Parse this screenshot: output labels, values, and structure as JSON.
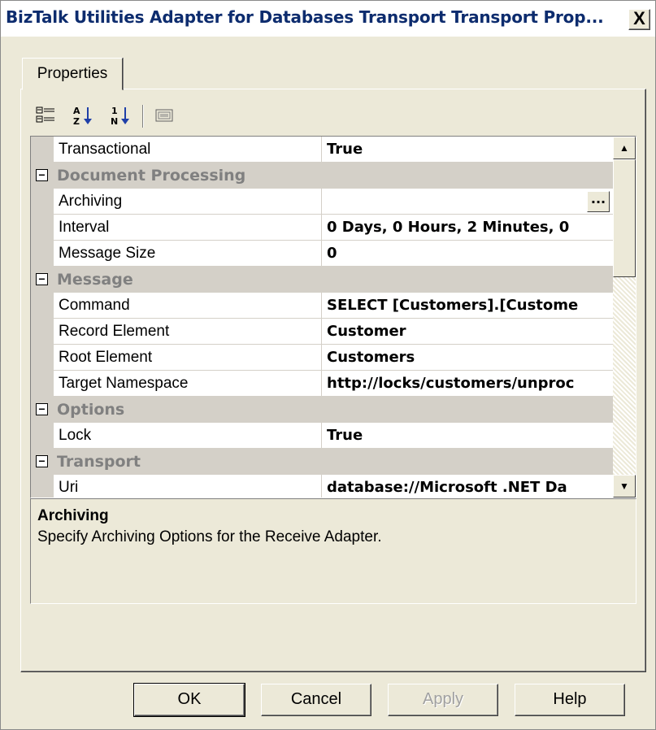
{
  "window": {
    "title": "BizTalk Utilities Adapter for Databases Transport Transport Prop...",
    "close_label": "X"
  },
  "tabs": [
    {
      "label": "Properties"
    }
  ],
  "toolbar": {
    "icons": [
      "categorized-icon",
      "alphabetical-icon",
      "sort-numeric-icon",
      "property-pages-icon"
    ]
  },
  "grid": {
    "rows": [
      {
        "type": "property",
        "name": "Transactional",
        "value": "True"
      },
      {
        "type": "category",
        "name": "Document Processing"
      },
      {
        "type": "property",
        "name": "Archiving",
        "value": "",
        "has_ellipsis": true
      },
      {
        "type": "property",
        "name": "Interval",
        "value": "0 Days, 0 Hours, 2 Minutes, 0"
      },
      {
        "type": "property",
        "name": "Message Size",
        "value": "0"
      },
      {
        "type": "category",
        "name": "Message"
      },
      {
        "type": "property",
        "name": "Command",
        "value": "SELECT [Customers].[Custome"
      },
      {
        "type": "property",
        "name": "Record Element",
        "value": "Customer"
      },
      {
        "type": "property",
        "name": "Root Element",
        "value": "Customers"
      },
      {
        "type": "property",
        "name": "Target Namespace",
        "value": "http://locks/customers/unproc"
      },
      {
        "type": "category",
        "name": "Options"
      },
      {
        "type": "property",
        "name": "Lock",
        "value": "True"
      },
      {
        "type": "category",
        "name": "Transport"
      },
      {
        "type": "property",
        "name": "Uri",
        "value": "database://Microsoft .NET Da"
      }
    ],
    "ellipsis_label": "...",
    "expander_glyph": "−",
    "scroll_up_glyph": "▲",
    "scroll_down_glyph": "▼"
  },
  "help": {
    "title": "Archiving",
    "description": "Specify Archiving Options for the Receive Adapter."
  },
  "buttons": {
    "ok": "OK",
    "cancel": "Cancel",
    "apply": "Apply",
    "help": "Help"
  }
}
